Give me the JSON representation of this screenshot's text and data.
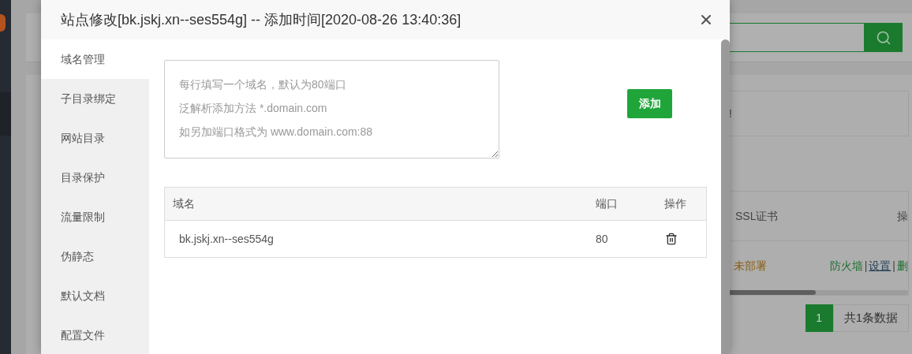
{
  "background": {
    "notice_text": "!",
    "table": {
      "columns": [
        "SSL证书",
        "操"
      ],
      "rows": [
        {
          "ssl": "未部署",
          "actions": [
            {
              "kind": "link",
              "text": "防火墙"
            },
            {
              "kind": "separator",
              "text": "|"
            },
            {
              "kind": "underlined",
              "text": "设置"
            },
            {
              "kind": "separator",
              "text": "|"
            },
            {
              "kind": "link",
              "text": "删"
            }
          ]
        }
      ]
    },
    "pagination": {
      "pages": [
        {
          "label": "1",
          "selected": true
        }
      ],
      "total": "共1条数据"
    }
  },
  "dialog": {
    "title": "站点修改[bk.jskj.xn--ses554g] -- 添加时间[2020-08-26 13:40:36]",
    "nav": [
      {
        "label": "域名管理",
        "selected": true
      },
      {
        "label": "子目录绑定",
        "selected": false
      },
      {
        "label": "网站目录",
        "selected": false
      },
      {
        "label": "目录保护",
        "selected": false
      },
      {
        "label": "流量限制",
        "selected": false
      },
      {
        "label": "伪静态",
        "selected": false
      },
      {
        "label": "默认文档",
        "selected": false
      },
      {
        "label": "配置文件",
        "selected": false
      }
    ],
    "domain_input": {
      "placeholder": [
        "每行填写一个域名，默认为80端口",
        "泛解析添加方法 *.domain.com",
        "如另加端口格式为 www.domain.com:88"
      ]
    },
    "add_button": "添加",
    "table": {
      "columns": [
        "域名",
        "端口",
        "操作"
      ],
      "rows": [
        {
          "domain": "bk.jskj.xn--ses554g",
          "port": "80"
        }
      ]
    }
  }
}
